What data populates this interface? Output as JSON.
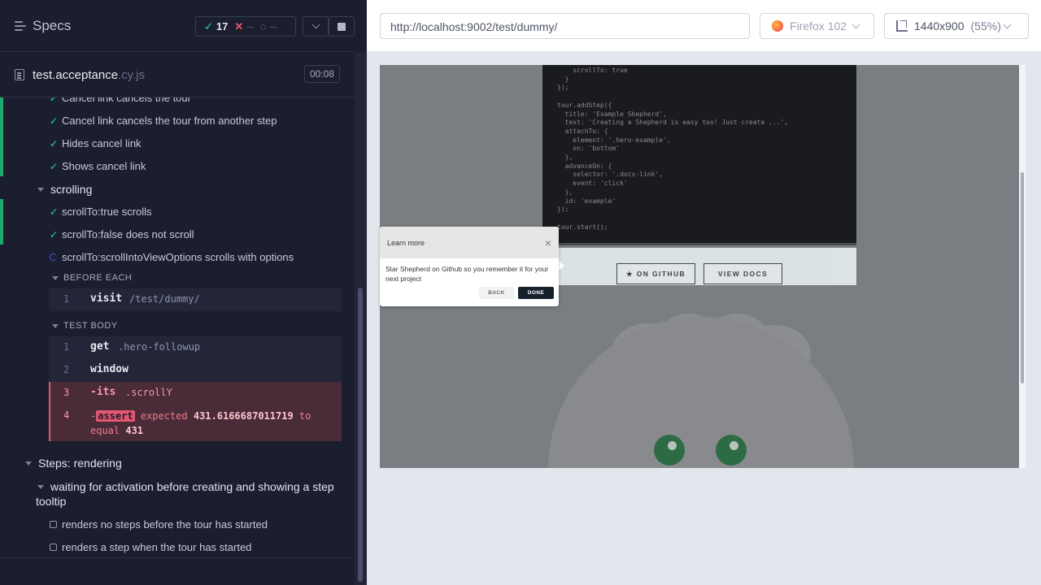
{
  "reporter": {
    "title": "Specs",
    "stats": {
      "passed": "17",
      "failed": "--",
      "pending": "--"
    },
    "file": {
      "name": "test.acceptance",
      "ext": ".cy.js",
      "duration": "00:08"
    },
    "tests": [
      {
        "title": "Cancel link cancels the tour",
        "state": "passed"
      },
      {
        "title": "Cancel link cancels the tour from another step",
        "state": "passed"
      },
      {
        "title": "Hides cancel link",
        "state": "passed"
      },
      {
        "title": "Shows cancel link",
        "state": "passed"
      }
    ],
    "suite_scrolling": "scrolling",
    "scroll_tests": [
      {
        "title": "scrollTo:true scrolls",
        "state": "passed"
      },
      {
        "title": "scrollTo:false does not scroll",
        "state": "passed"
      },
      {
        "title": "scrollTo:scrollIntoViewOptions scrolls with options",
        "state": "running"
      }
    ],
    "before_each_label": "BEFORE EACH",
    "before_each_cmds": [
      {
        "num": "1",
        "name": "visit",
        "arg": "/test/dummy/"
      }
    ],
    "test_body_label": "TEST BODY",
    "test_body_cmds": [
      {
        "num": "1",
        "name": "get",
        "arg": ".hero-followup"
      },
      {
        "num": "2",
        "name": "window",
        "arg": ""
      },
      {
        "num": "3",
        "name": "-its",
        "arg": ".scrollY"
      }
    ],
    "failed_cmd": {
      "num": "4",
      "prefix": "-",
      "name": "assert",
      "text1": "expected",
      "value1": "431.6166687011719",
      "text2": "to",
      "text3": "equal",
      "value2": "431"
    },
    "suite_rendering": "Steps: rendering",
    "sub_suite_line1": "waiting for activation before creating and showing a step",
    "sub_suite_line2": "tooltip",
    "pending_tests": [
      {
        "title": "renders no steps before the tour has started"
      },
      {
        "title": "renders a step when the tour has started"
      }
    ]
  },
  "aut": {
    "url": "http://localhost:9002/test/dummy/",
    "browser": "Firefox 102",
    "viewport": "1440x900",
    "scale": "(55%)",
    "code_lines": [
      "    scrollTo: true",
      "  }",
      "});",
      "",
      "tour.addStep({",
      "  title: 'Example Shepherd',",
      "  text: 'Creating a Shepherd is easy too! Just create ...',",
      "  attachTo: {",
      "    element: '.hero-example',",
      "    on: 'bottom'",
      "  },",
      "  advanceOn: {",
      "    selector: '.docs-link',",
      "    event: 'click'",
      "  },",
      "  id: 'example'",
      "});",
      "",
      "tour.start();"
    ],
    "github_button": "★ ON GITHUB",
    "docs_button": "VIEW DOCS",
    "tour": {
      "title": "Learn more",
      "close": "×",
      "text": "Star Shepherd on Github so you remember it for your next project",
      "back": "BACK",
      "done": "DONE"
    }
  },
  "colors": {
    "passed": "#1fa971",
    "failed": "#e45770",
    "running": "#4956e3",
    "reporter_bg": "#1b1e2e"
  }
}
